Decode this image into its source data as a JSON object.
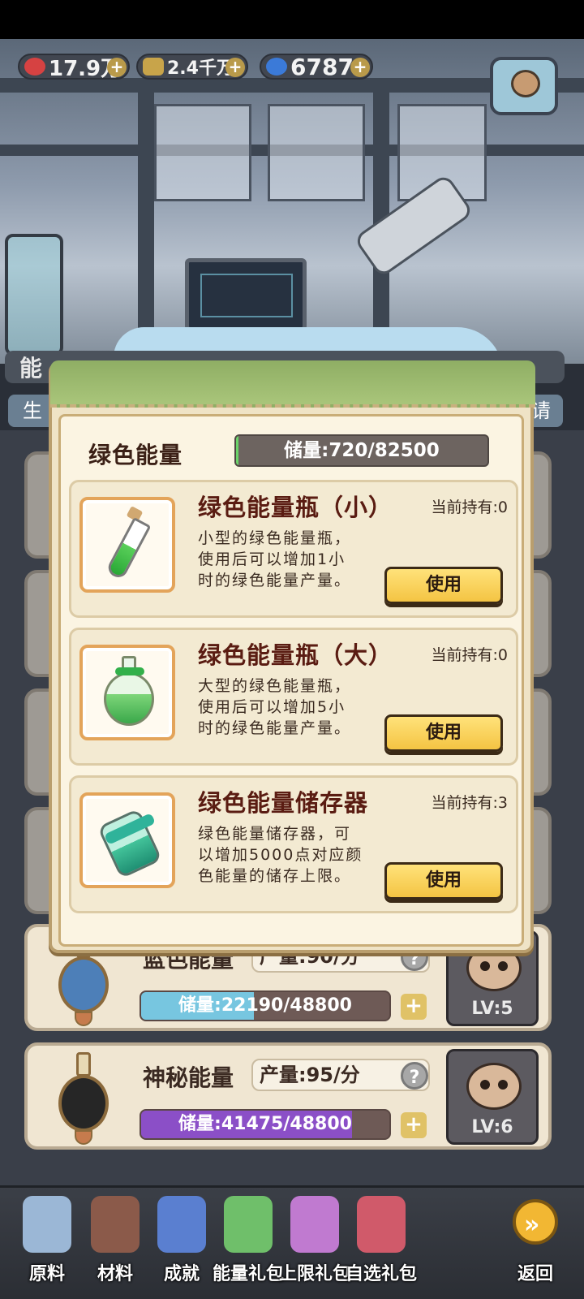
{
  "currencies": [
    {
      "name": "hearts",
      "value": "17.9万",
      "color": "#d64242"
    },
    {
      "name": "gold",
      "value": "2.4千万",
      "color": "#c8a44a"
    },
    {
      "name": "gems",
      "value": "6787",
      "color": "#3b7ad8"
    }
  ],
  "underlying": {
    "section_title": "能",
    "tab_left": "生",
    "tab_right": "请",
    "energy_cards": [
      {
        "name": "蓝色能量",
        "production": "产量:90/分",
        "storage_text": "储量:22190/48800",
        "storage_fraction": 0.455,
        "fill_color": "#77c6e0",
        "bottle_color": "#4d7fb8",
        "level": "LV:5"
      },
      {
        "name": "神秘能量",
        "production": "产量:95/分",
        "storage_text": "储量:41475/48800",
        "storage_fraction": 0.85,
        "fill_color": "#8b4fc7",
        "bottle_color": "#262626",
        "level": "LV:6"
      }
    ]
  },
  "modal": {
    "title": "绿色能量",
    "storage_text": "储量:720/82500",
    "storage_fraction": 0.009,
    "items": [
      {
        "name": "绿色能量瓶（小）",
        "holding": "当前持有:0",
        "desc_lines": [
          "小型的绿色能量瓶，",
          "使用后可以增加1小",
          "时的绿色能量产量。"
        ],
        "button": "使用",
        "icon": "small-vial-icon"
      },
      {
        "name": "绿色能量瓶（大）",
        "holding": "当前持有:0",
        "desc_lines": [
          "大型的绿色能量瓶，",
          "使用后可以增加5小",
          "时的绿色能量产量。"
        ],
        "button": "使用",
        "icon": "large-flask-icon"
      },
      {
        "name": "绿色能量储存器",
        "holding": "当前持有:3",
        "desc_lines": [
          "绿色能量储存器，可",
          "以增加5000点对应颜",
          "色能量的储存上限。"
        ],
        "button": "使用",
        "icon": "storage-canister-icon"
      }
    ]
  },
  "bottom_nav": [
    {
      "label": "原料",
      "icon": "ingredient-bottle-icon",
      "color": "#9bb7d6"
    },
    {
      "label": "材料",
      "icon": "mortar-icon",
      "color": "#8b5a4a"
    },
    {
      "label": "成就",
      "icon": "achievement-badge-icon",
      "color": "#5a7fd0"
    },
    {
      "label": "能量礼包",
      "icon": "energy-pack-icon",
      "color": "#6fbf6a"
    },
    {
      "label": "上限礼包",
      "icon": "limit-pack-icon",
      "color": "#c07ad0"
    },
    {
      "label": "自选礼包",
      "icon": "choice-pack-icon",
      "color": "#d05a6a"
    },
    {
      "label": "返回",
      "icon": "back-arrow-icon",
      "color": "#f2b733"
    }
  ]
}
